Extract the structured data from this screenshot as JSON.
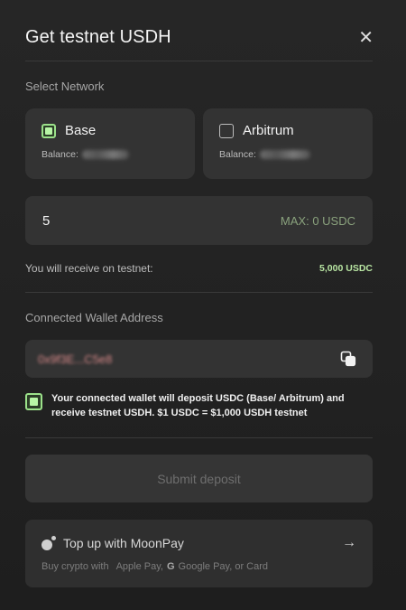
{
  "header": {
    "title": "Get testnet USDH",
    "close_glyph": "✕"
  },
  "network": {
    "label": "Select Network",
    "options": [
      {
        "name": "Base",
        "balance_label": "Balance:",
        "balance_value": "0.00 USDC",
        "checked": true
      },
      {
        "name": "Arbitrum",
        "balance_label": "Balance:",
        "balance_value": "0.00 USDC",
        "checked": false
      }
    ]
  },
  "amount": {
    "value": "5",
    "max_label": "MAX: 0 USDC"
  },
  "receive": {
    "label": "You will receive on testnet:",
    "value": "5,000 USDC"
  },
  "wallet": {
    "label": "Connected Wallet Address",
    "address": "0x9f3E...C5e8"
  },
  "confirm": {
    "checked": true,
    "text": "Your connected wallet will deposit USDC (Base/ Arbitrum) and receive testnet USDH. $1 USDC = $1,000 USDH testnet"
  },
  "submit": {
    "label": "Submit deposit"
  },
  "moonpay": {
    "title": "Top up with MoonPay",
    "arrow": "→",
    "sub_prefix": "Buy crypto with",
    "apple_icon": "",
    "apple_label": "Apple Pay,",
    "google_icon": "G",
    "google_label": "Google Pay, or Card"
  },
  "colors": {
    "accent_green": "#9be18a",
    "background": "#252525",
    "card": "#333333"
  }
}
